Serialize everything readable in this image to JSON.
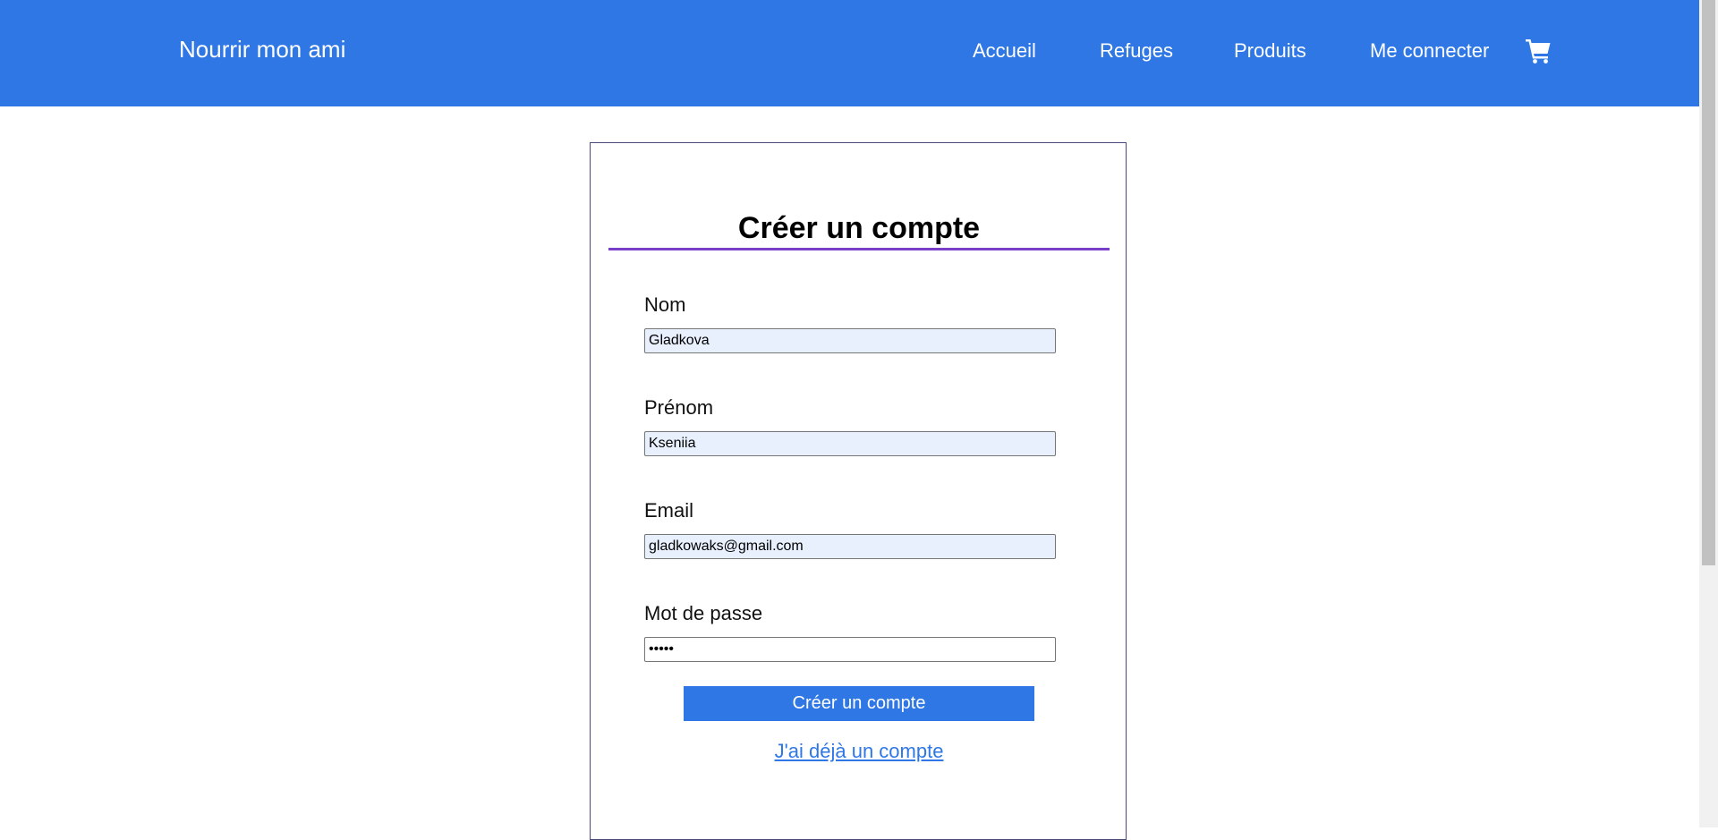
{
  "navbar": {
    "brand": "Nourrir mon ami",
    "links": [
      "Accueil",
      "Refuges",
      "Produits",
      "Me connecter"
    ],
    "cart_icon": "cart-icon",
    "background_color": "#2e77e5"
  },
  "form": {
    "title": "Créer un compte",
    "fields": [
      {
        "label": "Nom",
        "value": "Gladkova"
      },
      {
        "label": "Prénom",
        "value": "Kseniia"
      },
      {
        "label": "Email",
        "value": "gladkowaks@gmail.com"
      },
      {
        "label": "Mot de passe",
        "value": "•••••"
      }
    ],
    "submit_label": "Créer un compte",
    "login_link": "J'ai déjà un compte",
    "accent_color": "#7a3fc9"
  }
}
